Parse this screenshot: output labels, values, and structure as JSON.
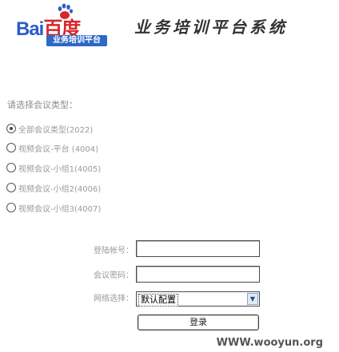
{
  "header": {
    "logo_text_a": "Bai",
    "logo_text_b": "百度",
    "logo_badge": "业务培训平台",
    "title": "业务培训平台系统"
  },
  "login_type": {
    "label": "请选择会议类型：",
    "options": [
      {
        "label": "全部会议类型(2022)",
        "checked": true
      },
      {
        "label": "视频会议-平台 (4004)",
        "checked": false
      },
      {
        "label": "视频会议-小组1(4005)",
        "checked": false
      },
      {
        "label": "视频会议-小组2(4006)",
        "checked": false
      },
      {
        "label": "视频会议-小组3(4007)",
        "checked": false
      }
    ]
  },
  "form": {
    "account_label": "登陆帐号：",
    "account_value": "",
    "password_label": "会议密码：",
    "password_value": "",
    "network_label": "网络选择：",
    "network_selected": "默认配置",
    "login_button": "登录"
  },
  "watermark": "WWW.wooyun.org"
}
